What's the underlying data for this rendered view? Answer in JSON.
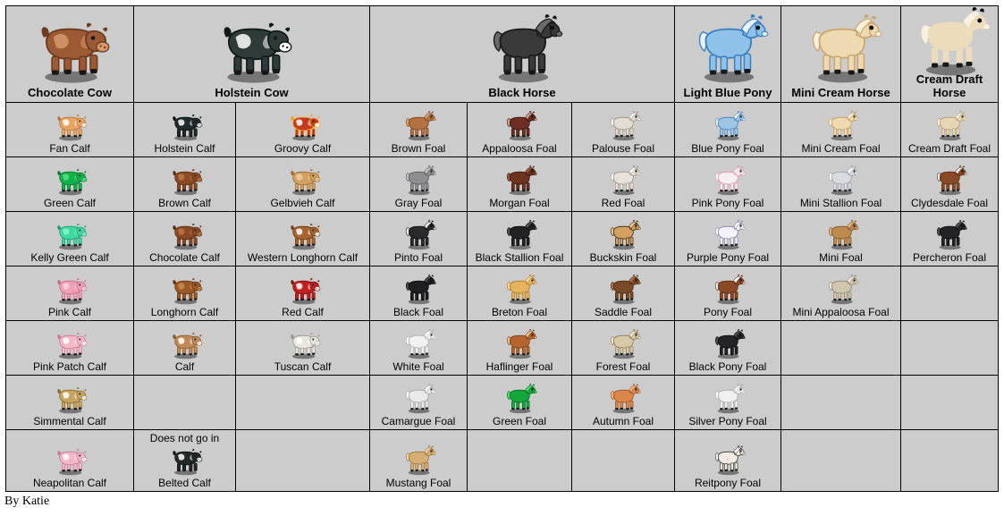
{
  "page": {
    "background": "#ffffff",
    "table_background": "#cccccc",
    "border_color": "#000000",
    "credit": "By Katie"
  },
  "header": {
    "row": [
      {
        "label": "Chocolate Cow",
        "icon": "chocolate-cow-art",
        "colspan": 1,
        "colors": {
          "body": "#9c5a34",
          "dark": "#6d3c21",
          "light": "#d79a6c"
        }
      },
      {
        "label": "Holstein Cow",
        "icon": "holstein-cow-art",
        "colspan": 2,
        "colors": {
          "body": "#2f3b3b",
          "dark": "#10191a",
          "light": "#ffffff"
        }
      },
      {
        "label": "Black Horse",
        "icon": "black-horse-art",
        "colspan": 3,
        "colors": {
          "body": "#3a3a3a",
          "dark": "#1a1a1a",
          "light": "#6a6a6a"
        }
      },
      {
        "label": "Light Blue Pony",
        "icon": "light-blue-pony-art",
        "colspan": 1,
        "colors": {
          "body": "#8ec2e8",
          "dark": "#3f7fbf",
          "light": "#e8f3fb"
        }
      },
      {
        "label": "Mini Cream Horse",
        "icon": "mini-cream-horse-art",
        "colspan": 1,
        "colors": {
          "body": "#efd9b0",
          "dark": "#c9a875",
          "light": "#fbf0da"
        }
      },
      {
        "label": "Cream Draft Horse",
        "icon": "cream-draft-horse-art",
        "colspan": 1,
        "colors": {
          "body": "#eddcbc",
          "dark": "#cbb храм88",
          "light": "#f9f1e0"
        }
      }
    ]
  },
  "grid": {
    "columns": 9,
    "rows": [
      [
        {
          "label": "Fan Calf",
          "type": "calf",
          "colors": {
            "body": "#e8a461",
            "dark": "#b8763a",
            "light": "#ffffff"
          }
        },
        {
          "label": "Holstein Calf",
          "type": "calf",
          "colors": {
            "body": "#20292b",
            "dark": "#0d1112",
            "light": "#ffffff"
          }
        },
        {
          "label": "Groovy Calf",
          "type": "calf",
          "colors": {
            "body": "#c23a1e",
            "dark": "#f2a21c",
            "light": "#ffffff"
          }
        },
        {
          "label": "Brown Foal",
          "type": "foal",
          "colors": {
            "body": "#b5703f",
            "dark": "#7d4a26",
            "light": "#d6a071"
          }
        },
        {
          "label": "Appaloosa Foal",
          "type": "foal",
          "colors": {
            "body": "#6e2f22",
            "dark": "#3a1710",
            "light": "#caa58f"
          }
        },
        {
          "label": "Palouse Foal",
          "type": "foal",
          "colors": {
            "body": "#e2dcd2",
            "dark": "#9c8f7e",
            "light": "#ffffff"
          }
        },
        {
          "label": "Blue Pony Foal",
          "type": "foal",
          "colors": {
            "body": "#9cc6e6",
            "dark": "#4b81b6",
            "light": "#e9f4fc"
          }
        },
        {
          "label": "Mini Cream Foal",
          "type": "foal",
          "colors": {
            "body": "#efd9ae",
            "dark": "#bd9c67",
            "light": "#fbf2e0"
          }
        },
        {
          "label": "Cream Draft Foal",
          "type": "foal",
          "colors": {
            "body": "#e6d6b4",
            "dark": "#b49f76",
            "light": "#f7efdd"
          }
        }
      ],
      [
        {
          "label": "Green Calf",
          "type": "calf",
          "colors": {
            "body": "#12b04a",
            "dark": "#0a7a32",
            "light": "#57e085"
          }
        },
        {
          "label": "Brown Calf",
          "type": "calf",
          "colors": {
            "body": "#8a4a22",
            "dark": "#5a2e13",
            "light": "#b87a46"
          }
        },
        {
          "label": "Gelbvieh Calf",
          "type": "calf",
          "colors": {
            "body": "#d2a061",
            "dark": "#9a6c32",
            "light": "#eccfa4"
          }
        },
        {
          "label": "Gray Foal",
          "type": "foal",
          "colors": {
            "body": "#8e8e90",
            "dark": "#5a5a5c",
            "light": "#c3c3c5"
          }
        },
        {
          "label": "Morgan Foal",
          "type": "foal",
          "colors": {
            "body": "#6d3320",
            "dark": "#3c1a0f",
            "light": "#9a5434"
          }
        },
        {
          "label": "Red Foal",
          "type": "foal",
          "colors": {
            "body": "#e8e2da",
            "dark": "#9d9287",
            "light": "#ffffff"
          }
        },
        {
          "label": "Pink Pony Foal",
          "type": "foal",
          "colors": {
            "body": "#f7f0f2",
            "dark": "#e28fae",
            "light": "#ffffff"
          }
        },
        {
          "label": "Mini Stallion Foal",
          "type": "foal",
          "colors": {
            "body": "#d8dce0",
            "dark": "#9aa2a8",
            "light": "#ffffff"
          }
        },
        {
          "label": "Clydesdale Foal",
          "type": "foal",
          "colors": {
            "body": "#8a4a26",
            "dark": "#5a2d13",
            "light": "#ffffff"
          }
        }
      ],
      [
        {
          "label": "Kelly Green Calf",
          "type": "calf",
          "colors": {
            "body": "#3fd9a0",
            "dark": "#1e9a6c",
            "light": "#8df0cb"
          }
        },
        {
          "label": "Chocolate Calf",
          "type": "calf",
          "colors": {
            "body": "#8b4a26",
            "dark": "#5a2d13",
            "light": "#b9783f"
          }
        },
        {
          "label": "Western Longhorn Calf",
          "type": "calf",
          "colors": {
            "body": "#a8642f",
            "dark": "#6f3c17",
            "light": "#ffffff"
          }
        },
        {
          "label": "Pinto Foal",
          "type": "foal",
          "colors": {
            "body": "#2a2a2c",
            "dark": "#141415",
            "light": "#ffffff"
          }
        },
        {
          "label": "Black Stallion Foal",
          "type": "foal",
          "colors": {
            "body": "#222224",
            "dark": "#0e0e0f",
            "light": "#50504f"
          }
        },
        {
          "label": "Buckskin Foal",
          "type": "foal",
          "colors": {
            "body": "#d3a05e",
            "dark": "#3a2a18",
            "light": "#edc891"
          }
        },
        {
          "label": "Purple Pony Foal",
          "type": "foal",
          "colors": {
            "body": "#f4f2f6",
            "dark": "#8a7fa8",
            "light": "#ffffff"
          }
        },
        {
          "label": "Mini Foal",
          "type": "foal",
          "colors": {
            "body": "#bd8a50",
            "dark": "#7d5627",
            "light": "#e0b784"
          }
        },
        {
          "label": "Percheron Foal",
          "type": "foal",
          "colors": {
            "body": "#232326",
            "dark": "#0f0f10",
            "light": "#4d4d50"
          }
        }
      ],
      [
        {
          "label": "Pink Calf",
          "type": "calf",
          "colors": {
            "body": "#f0a0b4",
            "dark": "#c46a82",
            "light": "#ffd6e0"
          }
        },
        {
          "label": "Longhorn Calf",
          "type": "calf",
          "colors": {
            "body": "#9a5a28",
            "dark": "#653715",
            "light": "#c98a4e"
          }
        },
        {
          "label": "Red Calf",
          "type": "calf",
          "colors": {
            "body": "#c02020",
            "dark": "#7d1212",
            "light": "#ffffff"
          }
        },
        {
          "label": "Black Foal",
          "type": "foal",
          "colors": {
            "body": "#1f1f21",
            "dark": "#0c0c0d",
            "light": "#484849"
          }
        },
        {
          "label": "Breton Foal",
          "type": "foal",
          "colors": {
            "body": "#e6b25e",
            "dark": "#a87a2c",
            "light": "#f7d79a"
          }
        },
        {
          "label": "Saddle Foal",
          "type": "foal",
          "colors": {
            "body": "#7a4a28",
            "dark": "#4a2a12",
            "light": "#a87048"
          }
        },
        {
          "label": "Pony Foal",
          "type": "foal",
          "colors": {
            "body": "#8a4a26",
            "dark": "#5a2a12",
            "light": "#ffffff"
          }
        },
        {
          "label": "Mini Appaloosa Foal",
          "type": "foal",
          "colors": {
            "body": "#cfc6ad",
            "dark": "#8f8570",
            "light": "#f0ead9"
          }
        },
        {
          "label": "",
          "type": "empty",
          "colors": {}
        }
      ],
      [
        {
          "label": "Pink Patch Calf",
          "type": "calf",
          "colors": {
            "body": "#f5b8c6",
            "dark": "#d0788e",
            "light": "#ffffff"
          }
        },
        {
          "label": "Calf",
          "type": "calf",
          "colors": {
            "body": "#c08a58",
            "dark": "#8a5a2c",
            "light": "#ffffff"
          }
        },
        {
          "label": "Tuscan Calf",
          "type": "calf",
          "colors": {
            "body": "#e9e6df",
            "dark": "#9a948a",
            "light": "#ffffff"
          }
        },
        {
          "label": "White Foal",
          "type": "foal",
          "colors": {
            "body": "#f2f2f2",
            "dark": "#b0b0b0",
            "light": "#ffffff"
          }
        },
        {
          "label": "Haflinger Foal",
          "type": "foal",
          "colors": {
            "body": "#b5662e",
            "dark": "#7a4016",
            "light": "#e8c48f"
          }
        },
        {
          "label": "Forest Foal",
          "type": "foal",
          "colors": {
            "body": "#d8c9a8",
            "dark": "#8a7a56",
            "light": "#f0e7cf"
          }
        },
        {
          "label": "Black Pony Foal",
          "type": "foal",
          "colors": {
            "body": "#242426",
            "dark": "#0e0e10",
            "light": "#4a4a4c"
          }
        },
        {
          "label": "",
          "type": "empty",
          "colors": {}
        },
        {
          "label": "",
          "type": "empty",
          "colors": {}
        }
      ],
      [
        {
          "label": "Simmental Calf",
          "type": "calf",
          "colors": {
            "body": "#c8a45e",
            "dark": "#8a6a2c",
            "light": "#ffffff"
          }
        },
        {
          "label": "",
          "type": "empty",
          "colors": {}
        },
        {
          "label": "",
          "type": "empty",
          "colors": {}
        },
        {
          "label": "Camargue Foal",
          "type": "foal",
          "colors": {
            "body": "#eaeaea",
            "dark": "#a5a5a5",
            "light": "#ffffff"
          }
        },
        {
          "label": "Green Foal",
          "type": "foal",
          "colors": {
            "body": "#14a83c",
            "dark": "#0a6e24",
            "light": "#4fd672"
          }
        },
        {
          "label": "Autumn Foal",
          "type": "foal",
          "colors": {
            "body": "#d9874a",
            "dark": "#9a5420",
            "light": "#f0b27e"
          }
        },
        {
          "label": "Silver Pony Foal",
          "type": "foal",
          "colors": {
            "body": "#f0f0f0",
            "dark": "#a8a8a8",
            "light": "#ffffff"
          }
        },
        {
          "label": "",
          "type": "empty",
          "colors": {}
        },
        {
          "label": "",
          "type": "empty",
          "colors": {}
        }
      ],
      [
        {
          "label": "Neapolitan Calf",
          "type": "calf",
          "colors": {
            "body": "#f4b6c8",
            "dark": "#c77a92",
            "light": "#ffffff"
          }
        },
        {
          "label": "Belted Calf",
          "note": "Does not go in",
          "type": "calf",
          "colors": {
            "body": "#24282a",
            "dark": "#101314",
            "light": "#ffffff"
          }
        },
        {
          "label": "",
          "type": "empty",
          "colors": {}
        },
        {
          "label": "Mustang Foal",
          "type": "foal",
          "colors": {
            "body": "#d6ae74",
            "dark": "#9a7440",
            "light": "#eed3a6"
          }
        },
        {
          "label": "",
          "type": "empty",
          "colors": {}
        },
        {
          "label": "",
          "type": "empty",
          "colors": {}
        },
        {
          "label": "Reitpony Foal",
          "type": "foal",
          "colors": {
            "body": "#f0ece4",
            "dark": "#3a3530",
            "light": "#ffffff"
          }
        },
        {
          "label": "",
          "type": "empty",
          "colors": {}
        },
        {
          "label": "",
          "type": "empty",
          "colors": {}
        }
      ]
    ]
  }
}
